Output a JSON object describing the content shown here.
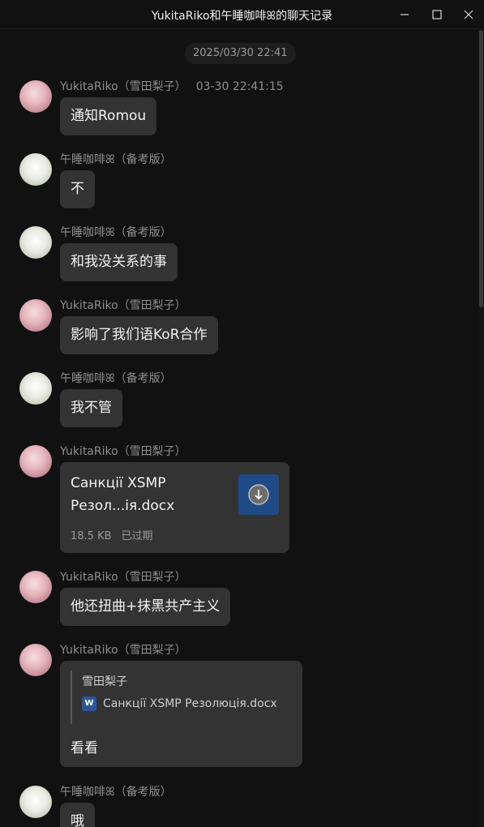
{
  "window": {
    "title": "YukitaRiko和午睡咖啡ꕤ的聊天记录"
  },
  "chat": {
    "date_chip": "2025/03/30 22:41",
    "messages": [
      {
        "sender": "YukitaRiko（雪田梨子）",
        "time": "03-30 22:41:15",
        "text": "通知Romou",
        "avatar": "avatar-yukitariko"
      },
      {
        "sender": "午睡咖啡ꕤ（备考版）",
        "text": "不",
        "avatar": "avatar-wushui"
      },
      {
        "sender": "午睡咖啡ꕤ（备考版）",
        "text": "和我没关系的事",
        "avatar": "avatar-wushui"
      },
      {
        "sender": "YukitaRiko（雪田梨子）",
        "text": "影响了我们语KoR合作",
        "avatar": "avatar-yukitariko"
      },
      {
        "sender": "午睡咖啡ꕤ（备考版）",
        "text": "我不管",
        "avatar": "avatar-wushui"
      },
      {
        "sender": "YukitaRiko（雪田梨子）",
        "file": {
          "name": "Санкції XSMP Резол...ія.docx",
          "size": "18.5 KB",
          "status": "已过期",
          "icon": "download-icon"
        },
        "avatar": "avatar-yukitariko"
      },
      {
        "sender": "YukitaRiko（雪田梨子）",
        "text": "他还扭曲+抹黑共产主义",
        "avatar": "avatar-yukitariko"
      },
      {
        "sender": "YukitaRiko（雪田梨子）",
        "quote": {
          "author": "雪田梨子",
          "file_name": "Санкції XSMP Резолюція.docx",
          "file_icon": "word-doc-icon"
        },
        "text": "看看",
        "avatar": "avatar-yukitariko"
      },
      {
        "sender": "午睡咖啡ꕤ（备考版）",
        "text": "哦",
        "avatar": "avatar-wushui"
      }
    ]
  },
  "icons": {
    "minimize": "minimize-icon",
    "maximize": "maximize-icon",
    "close": "close-icon"
  },
  "colors": {
    "background": "#111111",
    "bubble": "#333333",
    "file_icon_bg": "#1f4a86",
    "text": "#f2f2f2",
    "muted": "#8e8e8e"
  }
}
